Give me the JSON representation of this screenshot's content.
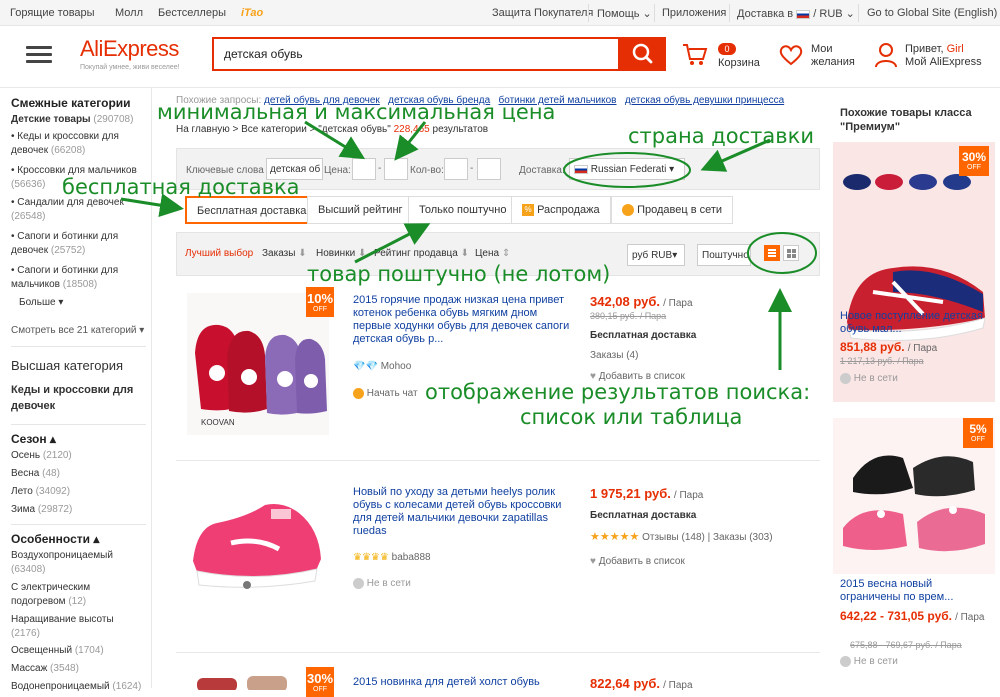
{
  "topbar": {
    "left": [
      "Горящие товары",
      "Молл",
      "Бестселлеры",
      "iTao"
    ],
    "right": [
      "Защита Покупателя",
      "Помощь",
      "Приложения",
      "Доставка в",
      "/ RUB",
      "Go to Global Site (English)"
    ]
  },
  "header": {
    "logo": "AliExpress",
    "logo_sub": "Покупай умнее, живи веселее!",
    "search_value": "детская обувь",
    "cart_label": "Корзина",
    "cart_count": "0",
    "wishlist": [
      "Мои",
      "желания"
    ],
    "greeting": "Привет,",
    "user": "Girl",
    "my_account": "Мой AliExpress"
  },
  "left": {
    "related_title": "Смежные категории",
    "children_shoes": "Детские товары",
    "children_count": "(290708)",
    "items": [
      {
        "label": "Кеды и кроссовки для девочек",
        "count": "(66208)"
      },
      {
        "label": "Кроссовки для мальчиков",
        "count": "(56636)"
      },
      {
        "label": "Сандалии для девочек",
        "count": "(26548)"
      },
      {
        "label": "Сапоги и ботинки для девочек",
        "count": "(25752)"
      },
      {
        "label": "Сапоги и ботинки для мальчиков",
        "count": "(18508)"
      }
    ],
    "more": "Больше",
    "see_all": "Смотреть все 21 категорий",
    "top_category_title": "Высшая категория",
    "top_category": "Кеды и кроссовки для девочек",
    "season_title": "Сезон",
    "seasons": [
      {
        "label": "Осень",
        "count": "(2120)"
      },
      {
        "label": "Весна",
        "count": "(48)"
      },
      {
        "label": "Лето",
        "count": "(34092)"
      },
      {
        "label": "Зима",
        "count": "(29872)"
      }
    ],
    "features_title": "Особенности",
    "features": [
      {
        "label": "Воздухопроницаемый",
        "count": "(63408)"
      },
      {
        "label": "С электрическим подогревом",
        "count": "(12)"
      },
      {
        "label": "Наращивание высоты",
        "count": "(2176)"
      },
      {
        "label": "Освещенный",
        "count": "(1704)"
      },
      {
        "label": "Массаж",
        "count": "(3548)"
      },
      {
        "label": "Водонепроницаемый",
        "count": "(1624)"
      }
    ]
  },
  "main": {
    "similar_label": "Похожие запросы:",
    "similar": [
      "детей обувь для девочек",
      "детская обувь бренда",
      "ботинки детей мальчиков",
      "детская обувь девушки принцесса"
    ],
    "breadcrumb": "На главную > Все категории > \"детская обувь\"",
    "result_count": "228,465",
    "results_word": "результатов",
    "keywords_label": "Ключевые слова :",
    "keywords_value": "детская об",
    "price_label": "Цена:",
    "qty_label": "Кол-во:",
    "delivery_label": "Доставка:",
    "delivery_value": "Russian Federati",
    "filters": [
      "Бесплатная доставка",
      "Высший рейтинг",
      "Только поштучно",
      "Распродажа",
      "Продавец в сети"
    ],
    "sort": [
      "Лучший выбор",
      "Заказы",
      "Новинки",
      "Рейтинг продавца",
      "Цена"
    ],
    "currency": "руб RUB",
    "unit_filter": "Поштучно"
  },
  "products": [
    {
      "badge": "10%",
      "title": "2015 горячие продаж низкая цена привет котенок ребенка обувь мягким дном первые ходунки обувь для девочек сапоги детская обувь р...",
      "seller": "Mohoo",
      "chat": "Начать чат",
      "price": "342,08 руб.",
      "unit": "/ Пара",
      "old_price": "380,15 руб. / Пара",
      "shipping": "Бесплатная доставка",
      "orders": "Заказы (4)",
      "wishlist": "Добавить в список"
    },
    {
      "badge": "",
      "title": "Новый по уходу за детьми heelys ролик обувь с колесами детей обувь кроссовки для детей мальчики девочки zapatillas ruedas",
      "seller": "baba888",
      "chat": "Не в сети",
      "price": "1 975,21 руб.",
      "unit": "/ Пара",
      "old_price": "",
      "shipping": "Бесплатная доставка",
      "orders": "Отзывы (148) | Заказы (303)",
      "wishlist": "Добавить в список"
    },
    {
      "badge": "30%",
      "title": "2015 новинка для детей холст обувь",
      "seller": "",
      "chat": "",
      "price": "822,64 руб.",
      "unit": "/ Пара",
      "old_price": "",
      "shipping": "",
      "orders": "",
      "wishlist": ""
    }
  ],
  "right": {
    "title": "Похожие товары класса \"Премиум\"",
    "items": [
      {
        "badge": "30%",
        "title": "Новое поступление детская обувь мал...",
        "price": "851,88 руб.",
        "unit": "/ Пара",
        "old_price": "1 217,13 руб. / Пара",
        "status": "Не в сети"
      },
      {
        "badge": "5%",
        "title": "2015 весна новый ограничены по врем...",
        "price": "642,22 - 731,05 руб.",
        "unit": "/ Пара",
        "old_price": "675,88 - 769,67 руб. / Пара",
        "status": "Не в сети"
      }
    ]
  },
  "annotations": {
    "min_max_price": "минимальная и максимальная цена",
    "ship_country": "страна доставки",
    "free_shipping": "бесплатная доставка",
    "single_item": "товар поштучно (не лотом)",
    "view_mode_1": "отображение результатов поиска:",
    "view_mode_2": "список или таблица"
  },
  "colors": {
    "accent": "#e62e04",
    "annotation": "#1a8d28",
    "link": "#1040a0"
  }
}
